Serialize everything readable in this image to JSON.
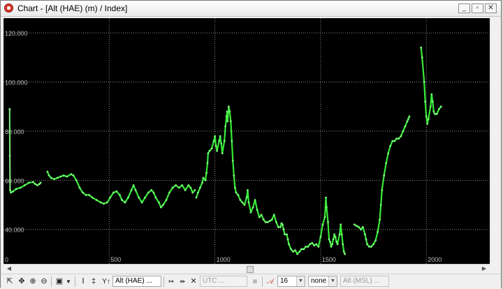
{
  "window": {
    "title": "Chart - [Alt (HAE) (m) / Index]",
    "buttons": {
      "minimize": "_",
      "restore": "▫",
      "close": "✕"
    }
  },
  "colors": {
    "background": "#000000",
    "series": "#37ea37",
    "grid": "#8a8a8a",
    "ticks": "#bfbfbf"
  },
  "chart_data": {
    "type": "line",
    "xlim": [
      0,
      2300
    ],
    "ylim": [
      26,
      126
    ],
    "x_ticks": [
      0,
      500,
      1000,
      1500,
      2000
    ],
    "x_tick_labels": [
      "0",
      "500",
      "1000",
      "1500",
      "2000"
    ],
    "y_ticks": [
      40,
      60,
      80,
      100,
      120
    ],
    "y_tick_labels": [
      "40.000",
      "60.000",
      "80.000",
      "100.000",
      "120.000"
    ],
    "grid": true,
    "series": [
      {
        "segments": [
          [
            [
              29,
              89
            ],
            [
              30,
              70
            ],
            [
              31,
              56
            ],
            [
              35,
              55
            ],
            [
              45,
              55.5
            ],
            [
              60,
              56.5
            ],
            [
              80,
              57
            ],
            [
              100,
              58
            ],
            [
              120,
              59
            ],
            [
              140,
              59.3
            ],
            [
              150,
              58.5
            ],
            [
              160,
              58
            ],
            [
              170,
              58.5
            ],
            [
              175,
              59
            ]
          ],
          [
            [
              208,
              63.5
            ],
            [
              215,
              62
            ],
            [
              225,
              61
            ],
            [
              240,
              60.5
            ],
            [
              255,
              61
            ],
            [
              270,
              61.5
            ],
            [
              285,
              62
            ],
            [
              300,
              61.5
            ],
            [
              320,
              62.5
            ],
            [
              330,
              62
            ],
            [
              345,
              60
            ],
            [
              360,
              57
            ],
            [
              375,
              55
            ],
            [
              390,
              54
            ],
            [
              405,
              54
            ],
            [
              420,
              53
            ],
            [
              440,
              52
            ],
            [
              460,
              51
            ],
            [
              475,
              50.5
            ],
            [
              490,
              51
            ],
            [
              505,
              53
            ],
            [
              520,
              55
            ],
            [
              535,
              55.5
            ],
            [
              550,
              54
            ],
            [
              560,
              52
            ],
            [
              575,
              51
            ],
            [
              590,
              53
            ],
            [
              605,
              56
            ],
            [
              615,
              58
            ],
            [
              625,
              56
            ],
            [
              640,
              53
            ],
            [
              655,
              51
            ],
            [
              670,
              53
            ],
            [
              685,
              55
            ],
            [
              700,
              56
            ],
            [
              710,
              55
            ],
            [
              720,
              53
            ],
            [
              735,
              51
            ],
            [
              745,
              49
            ],
            [
              755,
              50
            ],
            [
              770,
              52
            ],
            [
              785,
              55
            ],
            [
              800,
              57
            ],
            [
              815,
              58
            ],
            [
              830,
              57
            ],
            [
              845,
              58
            ],
            [
              860,
              56
            ],
            [
              875,
              58
            ],
            [
              885,
              57
            ],
            [
              895,
              55
            ],
            [
              905,
              56
            ]
          ],
          [
            [
              912,
              53
            ],
            [
              920,
              55
            ],
            [
              930,
              57
            ],
            [
              940,
              59
            ],
            [
              945,
              61
            ],
            [
              955,
              60
            ],
            [
              960,
              63
            ],
            [
              965,
              67
            ],
            [
              968,
              71
            ],
            [
              975,
              72
            ],
            [
              985,
              73
            ],
            [
              995,
              76
            ],
            [
              1000,
              78
            ],
            [
              1005,
              74
            ],
            [
              1010,
              72
            ],
            [
              1020,
              76
            ],
            [
              1025,
              78
            ],
            [
              1030,
              75
            ],
            [
              1035,
              71
            ],
            [
              1045,
              76
            ],
            [
              1050,
              82
            ],
            [
              1055,
              86
            ],
            [
              1058,
              88
            ],
            [
              1060,
              84
            ],
            [
              1065,
              90
            ],
            [
              1070,
              88
            ],
            [
              1075,
              84
            ],
            [
              1080,
              76
            ],
            [
              1085,
              68
            ],
            [
              1090,
              62
            ],
            [
              1095,
              57
            ],
            [
              1100,
              55
            ],
            [
              1110,
              54
            ],
            [
              1120,
              52
            ],
            [
              1130,
              51
            ],
            [
              1140,
              50
            ],
            [
              1150,
              53
            ],
            [
              1155,
              56
            ],
            [
              1160,
              51
            ],
            [
              1170,
              47
            ],
            [
              1180,
              49
            ],
            [
              1190,
              52
            ],
            [
              1200,
              48
            ],
            [
              1210,
              45
            ],
            [
              1220,
              46
            ],
            [
              1230,
              44
            ],
            [
              1240,
              43
            ],
            [
              1250,
              43
            ],
            [
              1260,
              43.5
            ],
            [
              1270,
              44
            ],
            [
              1280,
              46
            ],
            [
              1290,
              43
            ],
            [
              1300,
              41
            ],
            [
              1310,
              41
            ],
            [
              1315,
              42.5
            ],
            [
              1320,
              42
            ],
            [
              1325,
              40
            ],
            [
              1330,
              38
            ],
            [
              1340,
              38
            ],
            [
              1345,
              36
            ],
            [
              1350,
              34
            ],
            [
              1360,
              32
            ],
            [
              1370,
              31
            ],
            [
              1380,
              31.5
            ],
            [
              1390,
              30
            ],
            [
              1400,
              31
            ],
            [
              1410,
              32
            ],
            [
              1420,
              32
            ],
            [
              1430,
              33
            ],
            [
              1440,
              33
            ],
            [
              1450,
              34
            ],
            [
              1460,
              34.5
            ],
            [
              1470,
              33.5
            ],
            [
              1480,
              34
            ],
            [
              1490,
              33
            ],
            [
              1500,
              37
            ],
            [
              1510,
              42
            ],
            [
              1520,
              45
            ],
            [
              1525,
              53
            ],
            [
              1528,
              49
            ],
            [
              1535,
              43
            ],
            [
              1540,
              36
            ],
            [
              1545,
              35
            ],
            [
              1550,
              33
            ],
            [
              1555,
              34
            ],
            [
              1560,
              36
            ],
            [
              1565,
              38
            ],
            [
              1570,
              37
            ],
            [
              1575,
              35
            ],
            [
              1580,
              34
            ],
            [
              1590,
              38
            ],
            [
              1595,
              42
            ],
            [
              1600,
              38
            ],
            [
              1605,
              34
            ],
            [
              1610,
              31
            ],
            [
              1615,
              30
            ]
          ],
          [
            [
              1660,
              42
            ],
            [
              1670,
              41.5
            ],
            [
              1680,
              41
            ],
            [
              1690,
              40
            ],
            [
              1700,
              41
            ],
            [
              1710,
              38
            ],
            [
              1715,
              36
            ],
            [
              1720,
              34
            ],
            [
              1730,
              33
            ],
            [
              1740,
              33
            ],
            [
              1750,
              34
            ],
            [
              1760,
              35.5
            ],
            [
              1770,
              39
            ],
            [
              1780,
              44
            ],
            [
              1785,
              50
            ],
            [
              1790,
              56
            ],
            [
              1800,
              62
            ],
            [
              1810,
              67
            ],
            [
              1820,
              71
            ],
            [
              1830,
              74
            ],
            [
              1840,
              76
            ],
            [
              1850,
              76
            ],
            [
              1860,
              77
            ],
            [
              1870,
              77
            ],
            [
              1880,
              78
            ],
            [
              1890,
              80
            ],
            [
              1900,
              82
            ],
            [
              1910,
              84
            ],
            [
              1915,
              85
            ],
            [
              1920,
              86
            ]
          ],
          [
            [
              1975,
              114
            ],
            [
              1980,
              110
            ],
            [
              1990,
              100
            ],
            [
              1995,
              92
            ],
            [
              2000,
              86
            ],
            [
              2005,
              83
            ],
            [
              2010,
              85
            ],
            [
              2020,
              90
            ],
            [
              2025,
              95
            ],
            [
              2030,
              92
            ],
            [
              2035,
              88
            ],
            [
              2040,
              87
            ],
            [
              2050,
              87
            ],
            [
              2060,
              89
            ],
            [
              2070,
              90
            ]
          ]
        ]
      }
    ]
  },
  "toolbar": {
    "y_series_label": "Alt (HAE) ...",
    "time_combo": "UTC ...",
    "symbol_size": "16",
    "style_combo": "none",
    "y2_series_label": "Alt (MSL) ..."
  }
}
